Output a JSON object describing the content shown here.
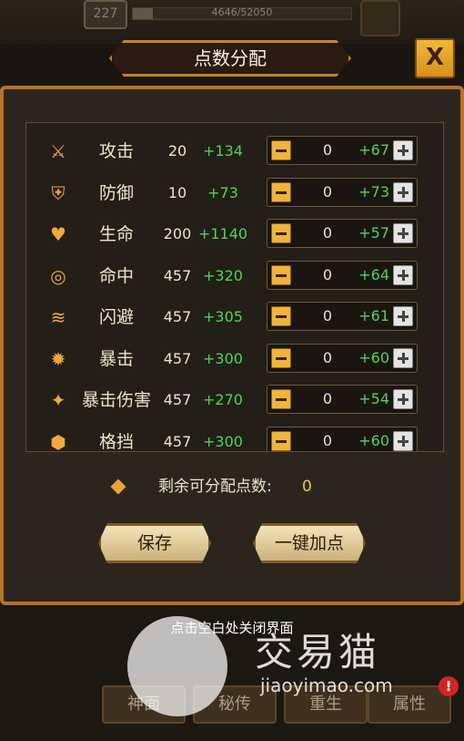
{
  "header": {
    "level": "227",
    "exp_text": "4646/52050",
    "title": "点数分配",
    "close_symbol": "X"
  },
  "stats": [
    {
      "icon": "sword-icon",
      "name": "攻击",
      "base": "20",
      "bonus": "+134",
      "alloc": "0",
      "alloc_bonus": "+67"
    },
    {
      "icon": "shield-icon",
      "name": "防御",
      "base": "10",
      "bonus": "+73",
      "alloc": "0",
      "alloc_bonus": "+73"
    },
    {
      "icon": "heart-icon",
      "name": "生命",
      "base": "200",
      "bonus": "+1140",
      "alloc": "0",
      "alloc_bonus": "+57"
    },
    {
      "icon": "target-icon",
      "name": "命中",
      "base": "457",
      "bonus": "+320",
      "alloc": "0",
      "alloc_bonus": "+64"
    },
    {
      "icon": "dodge-icon",
      "name": "闪避",
      "base": "457",
      "bonus": "+305",
      "alloc": "0",
      "alloc_bonus": "+61"
    },
    {
      "icon": "crit-icon",
      "name": "暴击",
      "base": "457",
      "bonus": "+300",
      "alloc": "0",
      "alloc_bonus": "+60"
    },
    {
      "icon": "crit-damage-icon",
      "name": "暴击伤害",
      "base": "457",
      "bonus": "+270",
      "alloc": "0",
      "alloc_bonus": "+54"
    },
    {
      "icon": "block-icon",
      "name": "格挡",
      "base": "457",
      "bonus": "+300",
      "alloc": "0",
      "alloc_bonus": "+60"
    }
  ],
  "remaining": {
    "label": "剩余可分配点数:",
    "value": "0"
  },
  "buttons": {
    "save": "保存",
    "auto": "一键加点"
  },
  "hint": "点击空白处关闭界面",
  "bottom_tabs": [
    "神面",
    "秘传",
    "重生",
    "属性"
  ],
  "badge": "!",
  "watermark": {
    "name": "交易猫",
    "domain": "jiaoyimao.com"
  },
  "colors": {
    "accent": "#b77426",
    "bonus_green": "#4fd64f",
    "gold": "#f2c94c"
  }
}
